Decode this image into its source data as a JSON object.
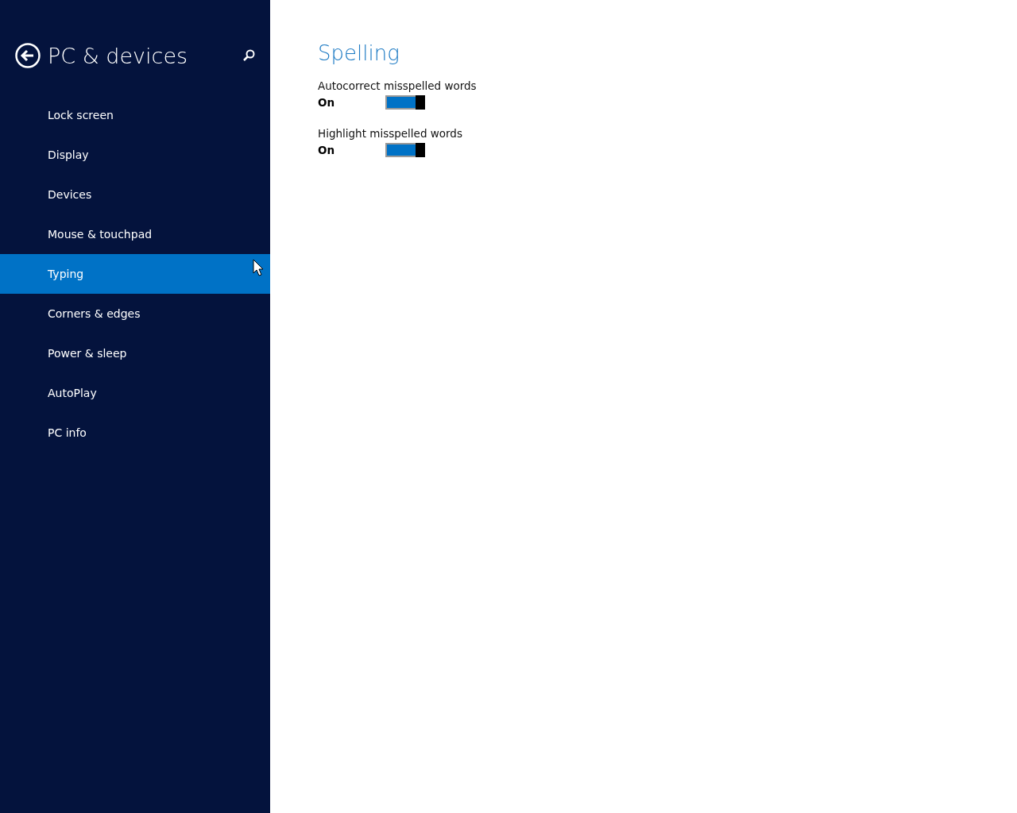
{
  "sidebar": {
    "title": "PC & devices",
    "items": [
      {
        "label": "Lock screen",
        "selected": false
      },
      {
        "label": "Display",
        "selected": false
      },
      {
        "label": "Devices",
        "selected": false
      },
      {
        "label": "Mouse & touchpad",
        "selected": false
      },
      {
        "label": "Typing",
        "selected": true
      },
      {
        "label": "Corners & edges",
        "selected": false
      },
      {
        "label": "Power & sleep",
        "selected": false
      },
      {
        "label": "AutoPlay",
        "selected": false
      },
      {
        "label": "PC info",
        "selected": false
      }
    ]
  },
  "content": {
    "heading": "Spelling",
    "settings": [
      {
        "label": "Autocorrect misspelled words",
        "state": "On",
        "on": true
      },
      {
        "label": "Highlight misspelled words",
        "state": "On",
        "on": true
      }
    ]
  }
}
